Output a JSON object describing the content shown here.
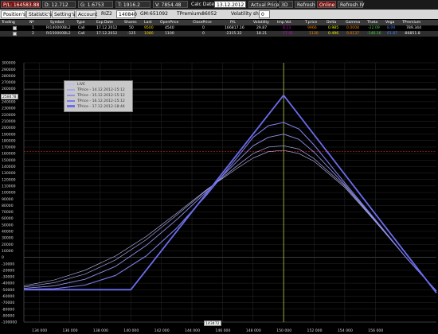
{
  "toolbar": {
    "pl": "P/L: 164583.88",
    "delta": "D: 12.712",
    "gamma": "G: 1.6753",
    "theta": "T: 1916.2",
    "vega": "V: 7854.48",
    "calc_date_label": "Calc Date:",
    "calc_date_value": "13.12.2012",
    "actual_price": "Actual Price",
    "mode_3d": "3D",
    "refresh": "Refresh",
    "online": "Online",
    "refresh_iv": "Refresh IV"
  },
  "bar2": {
    "tabs": [
      "Position's",
      "Statistic's",
      "Setting's",
      "Account"
    ],
    "symbol": "RIZ2",
    "price": "140840",
    "gm_label": "GM:",
    "gm_value": "651092",
    "tpremium_label": "TPremium:",
    "tpremium_value": "-86052",
    "vol_shift_label": "Volatility shift:",
    "vol_shift_value": "0"
  },
  "table": {
    "headers": [
      "Trading",
      "Nº",
      "Symbol",
      "Type",
      "Exp.Date",
      "Shares",
      "Last",
      "OpenPrice",
      "ClosePrice",
      "P/L",
      "Volatility",
      "Imp.Vol.",
      "T.price",
      "Delta",
      "Gamma",
      "Theta",
      "Vega",
      "TPremium"
    ],
    "rows": [
      [
        "",
        "1",
        "RI140000BL2",
        "Call",
        "17.12.2012",
        "50",
        "9500",
        "4540",
        "0",
        "166817.16",
        "29.87",
        "8.23",
        "9966",
        "0.985",
        "0.0008",
        "-22.09",
        "8.09",
        "789.344"
      ],
      [
        "",
        "2",
        "RI150000BL2",
        "Call",
        "17.12.2012",
        "-125",
        "1080",
        "1100",
        "0",
        "-2315.32",
        "18.21",
        "17.41",
        "1130",
        "0.496",
        "0.0137",
        "-140.16",
        "61.87",
        "-86851.8"
      ]
    ]
  },
  "chart_data": {
    "type": "line",
    "xlim": [
      133000,
      160000
    ],
    "ylim": [
      -100000,
      300000
    ],
    "x_ticks": [
      134000,
      136000,
      138000,
      140000,
      142000,
      144000,
      146000,
      148000,
      150000,
      152000,
      154000,
      156000
    ],
    "x_tick_labels": [
      "134 000",
      "136 000",
      "138 000",
      "140 000",
      "142 000",
      "144 000",
      "146 000",
      "148 000",
      "150 000",
      "152 000",
      "154 000",
      "156 000"
    ],
    "y_tick_step": 10000,
    "current_price_marker": "143472",
    "y_readout": "258478",
    "vertical_marker_x": 150000,
    "horizontal_marker_y": 163000,
    "series": [
      {
        "name": "LIVE",
        "color": "#bdbdf2",
        "width": 0.6,
        "x": [
          133000,
          135000,
          137000,
          139000,
          141000,
          143000,
          145000,
          147000,
          148000,
          149000,
          150000,
          151000,
          152000,
          154000,
          156000,
          158000,
          160000
        ],
        "y": [
          -44000,
          -35000,
          -20000,
          2000,
          32000,
          68000,
          105000,
          138000,
          153000,
          163000,
          165000,
          160000,
          148000,
          108000,
          55000,
          0,
          -52000
        ]
      },
      {
        "name": "TPrice - 14.12.2012-15:12",
        "color": "#a7a7ee",
        "width": 0.7,
        "x": [
          133000,
          135000,
          137000,
          139000,
          141000,
          143000,
          145000,
          147000,
          148000,
          149000,
          150000,
          151000,
          152000,
          154000,
          156000,
          158000,
          160000
        ],
        "y": [
          -46000,
          -39000,
          -26000,
          -4000,
          27000,
          65000,
          104000,
          142000,
          160000,
          170000,
          172000,
          167000,
          152000,
          110000,
          56000,
          0,
          -52000
        ]
      },
      {
        "name": "TPrice - 15.12.2012-15:12",
        "color": "#9090ea",
        "width": 0.9,
        "x": [
          133000,
          135000,
          137000,
          139000,
          141000,
          143000,
          145000,
          147000,
          148000,
          149000,
          150000,
          151000,
          152000,
          154000,
          156000,
          158000,
          160000
        ],
        "y": [
          -48000,
          -44000,
          -34000,
          -14000,
          18000,
          58000,
          102000,
          149000,
          172000,
          185000,
          190000,
          182000,
          162000,
          112000,
          57000,
          0,
          -52000
        ]
      },
      {
        "name": "TPrice - 16.12.2012-15:12",
        "color": "#7c7ce8",
        "width": 1.1,
        "x": [
          133000,
          135000,
          137000,
          139000,
          141000,
          143000,
          145000,
          147000,
          148000,
          149000,
          150000,
          151000,
          152000,
          154000,
          156000,
          158000,
          160000
        ],
        "y": [
          -49500,
          -48500,
          -43000,
          -28000,
          2000,
          45000,
          97000,
          155000,
          185000,
          203000,
          208000,
          198000,
          173000,
          115000,
          58000,
          0,
          -52000
        ]
      },
      {
        "name": "TPrice - 17.12.2012-18:44",
        "color": "#6c6cf0",
        "width": 1.8,
        "x": [
          133000,
          140000,
          150000,
          160000
        ],
        "y": [
          -50000,
          -50000,
          250000,
          -55000
        ]
      }
    ]
  }
}
